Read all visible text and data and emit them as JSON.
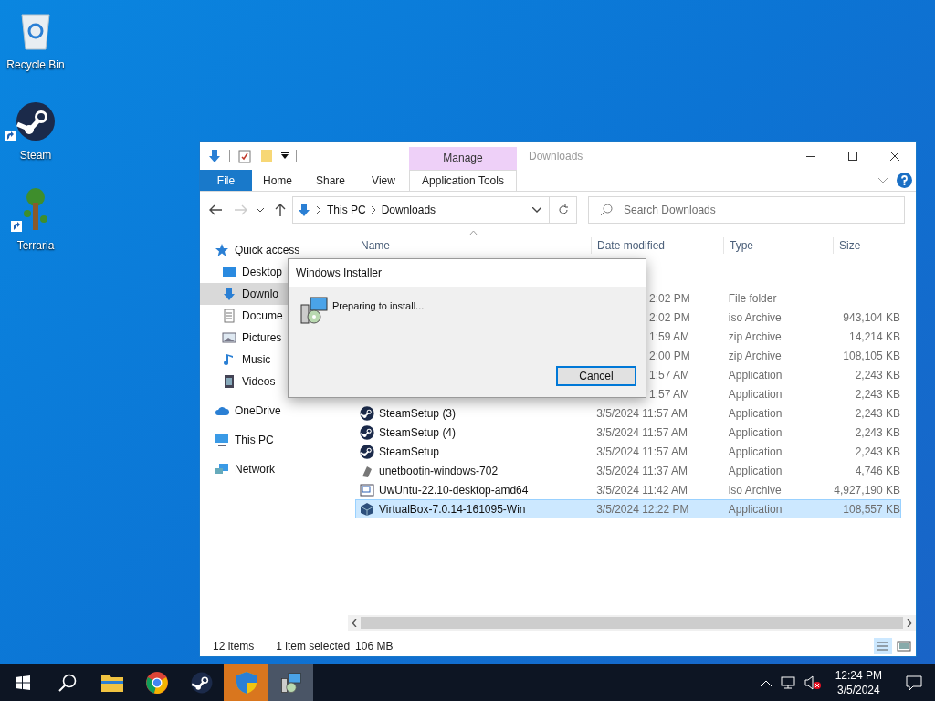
{
  "desktop_icons": [
    {
      "label": "Recycle Bin",
      "kind": "recycle",
      "shortcut": false
    },
    {
      "label": "Steam",
      "kind": "steam",
      "shortcut": true
    },
    {
      "label": "Terraria",
      "kind": "tree",
      "shortcut": true
    }
  ],
  "explorer": {
    "title": "Downloads",
    "context_tab": "Manage",
    "ribbon_tabs": [
      {
        "label": "File",
        "kind": "file",
        "selected": false
      },
      {
        "label": "Home",
        "kind": "tab",
        "selected": false
      },
      {
        "label": "Share",
        "kind": "tab",
        "selected": false
      },
      {
        "label": "View",
        "kind": "tab",
        "selected": false
      },
      {
        "label": "Application Tools",
        "kind": "context",
        "selected": true
      }
    ],
    "breadcrumb": [
      "This PC",
      "Downloads"
    ],
    "search_placeholder": "Search Downloads",
    "sidebar": [
      {
        "label": "Quick access",
        "kind": "star",
        "selected": false,
        "children": [
          {
            "label": "Desktop",
            "kind": "desktop",
            "selected": false
          },
          {
            "label": "Downlo",
            "kind": "download",
            "selected": true
          },
          {
            "label": "Docume",
            "kind": "document",
            "selected": false
          },
          {
            "label": "Pictures",
            "kind": "pictures",
            "selected": false
          },
          {
            "label": "Music",
            "kind": "music",
            "selected": false
          },
          {
            "label": "Videos",
            "kind": "videos",
            "selected": false
          }
        ]
      },
      {
        "label": "OneDrive",
        "kind": "cloud",
        "selected": false
      },
      {
        "label": "This PC",
        "kind": "pc",
        "selected": false
      },
      {
        "label": "Network",
        "kind": "network",
        "selected": false
      }
    ],
    "columns": [
      "Name",
      "Date modified",
      "Type",
      "Size"
    ],
    "rows": [
      {
        "date": "2:02 PM",
        "type": "File folder",
        "selected": false
      },
      {
        "date": "2:02 PM",
        "type": "iso Archive",
        "size": "943,104 KB",
        "selected": false
      },
      {
        "date": "1:59 AM",
        "type": "zip Archive",
        "size": "14,214 KB",
        "selected": false
      },
      {
        "date": "2:00 PM",
        "type": "zip Archive",
        "size": "108,105 KB",
        "selected": false
      },
      {
        "date": "1:57 AM",
        "type": "Application",
        "size": "2,243 KB",
        "selected": false
      },
      {
        "date": "1:57 AM",
        "type": "Application",
        "size": "2,243 KB",
        "selected": false
      },
      {
        "kind": "steam",
        "name": "SteamSetup (3)",
        "date": "3/5/2024 11:57 AM",
        "type": "Application",
        "size": "2,243 KB",
        "selected": false
      },
      {
        "kind": "steam",
        "name": "SteamSetup (4)",
        "date": "3/5/2024 11:57 AM",
        "type": "Application",
        "size": "2,243 KB",
        "selected": false
      },
      {
        "kind": "steam",
        "name": "SteamSetup",
        "date": "3/5/2024 11:57 AM",
        "type": "Application",
        "size": "2,243 KB",
        "selected": false
      },
      {
        "kind": "unetbootin",
        "name": "unetbootin-windows-702",
        "date": "3/5/2024 11:37 AM",
        "type": "Application",
        "size": "4,746 KB",
        "selected": false
      },
      {
        "kind": "iso",
        "name": "UwUntu-22.10-desktop-amd64",
        "date": "3/5/2024 11:42 AM",
        "type": "iso Archive",
        "size": "4,927,190 KB",
        "selected": false
      },
      {
        "kind": "box",
        "name": "VirtualBox-7.0.14-161095-Win",
        "date": "3/5/2024 12:22 PM",
        "type": "Application",
        "size": "108,557 KB",
        "selected": true
      }
    ],
    "status": {
      "count": "12 items",
      "selection": "1 item selected",
      "size": "106 MB"
    }
  },
  "dialog": {
    "title": "Windows Installer",
    "message": "Preparing to install...",
    "button": "Cancel"
  },
  "taskbar": {
    "apps": [
      {
        "kind": "start"
      },
      {
        "kind": "search"
      },
      {
        "kind": "folder"
      },
      {
        "kind": "chrome"
      },
      {
        "kind": "steam"
      },
      {
        "kind": "shield",
        "color": "#d9761e"
      },
      {
        "kind": "installer",
        "color": "#4a5566"
      }
    ],
    "time": "12:24 PM",
    "date": "3/5/2024"
  }
}
